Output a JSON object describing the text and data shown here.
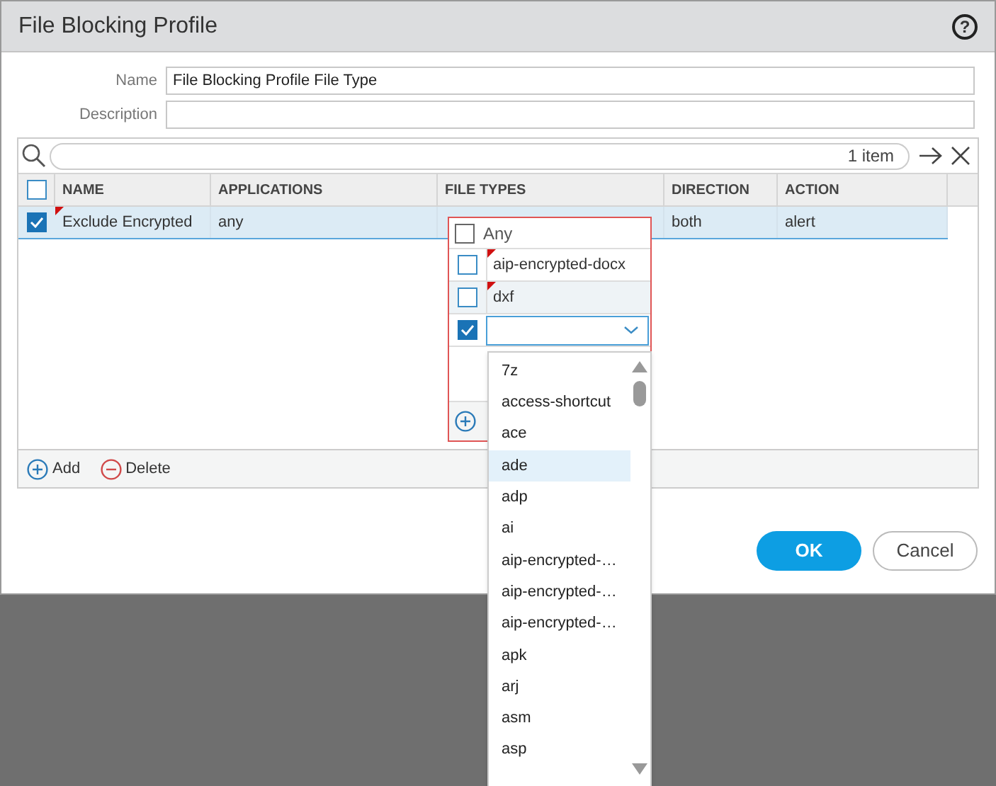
{
  "window": {
    "title": "File Blocking Profile",
    "help": "?"
  },
  "form": [
    {
      "label": "Name",
      "value": "File Blocking Profile File Type"
    },
    {
      "label": "Description"
    }
  ],
  "grid": {
    "search": {
      "count": "1 item"
    },
    "header_checked": false,
    "columns": [
      "NAME",
      "APPLICATIONS",
      "FILE TYPES",
      "DIRECTION",
      "ACTION"
    ],
    "rows": [
      {
        "checked": true,
        "selected": true,
        "edited": true,
        "cells": [
          "Exclude Encrypted",
          "any",
          "",
          "both",
          "alert"
        ]
      }
    ],
    "footer": [
      {
        "kind": "add",
        "label": "Add"
      },
      {
        "kind": "delete",
        "label": "Delete"
      }
    ]
  },
  "file_types_editor": {
    "any": {
      "label": "Any",
      "checked": false
    },
    "items": [
      {
        "label": "aip-encrypted-docx",
        "checked": false,
        "edited": true
      },
      {
        "label": "dxf",
        "checked": false,
        "edited": true
      },
      {
        "checked": true,
        "kind": "select"
      }
    ]
  },
  "dropdown": {
    "items": [
      {
        "label": "7z",
        "selected": false
      },
      {
        "label": "access-shortcut",
        "selected": false
      },
      {
        "label": "ace",
        "selected": false
      },
      {
        "label": "ade",
        "selected": true
      },
      {
        "label": "adp",
        "selected": false
      },
      {
        "label": "ai",
        "selected": false
      },
      {
        "label": "aip-encrypted-…",
        "selected": false
      },
      {
        "label": "aip-encrypted-…",
        "selected": false
      },
      {
        "label": "aip-encrypted-…",
        "selected": false
      },
      {
        "label": "apk",
        "selected": false
      },
      {
        "label": "arj",
        "selected": false
      },
      {
        "label": "asm",
        "selected": false
      },
      {
        "label": "asp",
        "selected": false
      }
    ]
  },
  "buttons": [
    {
      "kind": "primary",
      "label": "OK"
    },
    {
      "kind": "secondary",
      "label": "Cancel"
    }
  ]
}
